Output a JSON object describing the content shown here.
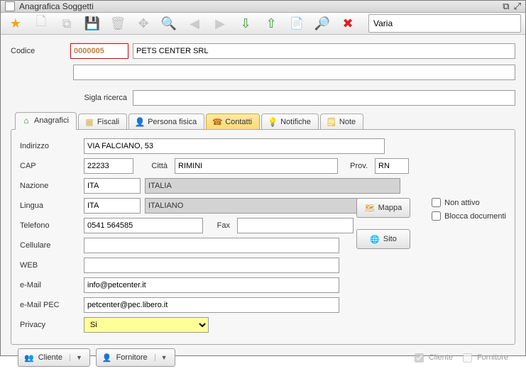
{
  "window": {
    "title": "Anagrafica Soggetti"
  },
  "toolbar": {
    "search_value": "Varia"
  },
  "header": {
    "codice_label": "Codice",
    "codice_value": "0000005",
    "name_value": "PETS CENTER SRL",
    "sigla_label": "Sigla ricerca",
    "sigla_value": ""
  },
  "tabs": {
    "anagrafici": "Anagrafici",
    "fiscali": "Fiscali",
    "persona": "Persona fisica",
    "contatti": "Contatti",
    "notifiche": "Notifiche",
    "note": "Note"
  },
  "form": {
    "indirizzo_label": "Indirizzo",
    "indirizzo": "VIA FALCIANO, 53",
    "cap_label": "CAP",
    "cap": "22233",
    "citta_label": "Città",
    "citta": "RIMINI",
    "prov_label": "Prov.",
    "prov": "RN",
    "nazione_label": "Nazione",
    "nazione_code": "ITA",
    "nazione_name": "ITALIA",
    "lingua_label": "Lingua",
    "lingua_code": "ITA",
    "lingua_name": "ITALIANO",
    "telefono_label": "Telefono",
    "telefono": "0541 564585",
    "fax_label": "Fax",
    "fax": "",
    "cellulare_label": "Cellulare",
    "cellulare": "",
    "web_label": "WEB",
    "web": "",
    "email_label": "e-Mail",
    "email": "info@petcenter.it",
    "emailpec_label": "e-Mail PEC",
    "emailpec": "petcenter@pec.libero.it",
    "privacy_label": "Privacy",
    "privacy_value": "Si"
  },
  "buttons": {
    "mappa": "Mappa",
    "sito": "Sito"
  },
  "checks": {
    "non_attivo": "Non attivo",
    "blocca_doc": "Blocca documenti"
  },
  "footer": {
    "cliente_btn": "Cliente",
    "fornitore_btn": "Fornitore",
    "cliente_chk": "Cliente",
    "fornitore_chk": "Fornitore"
  }
}
